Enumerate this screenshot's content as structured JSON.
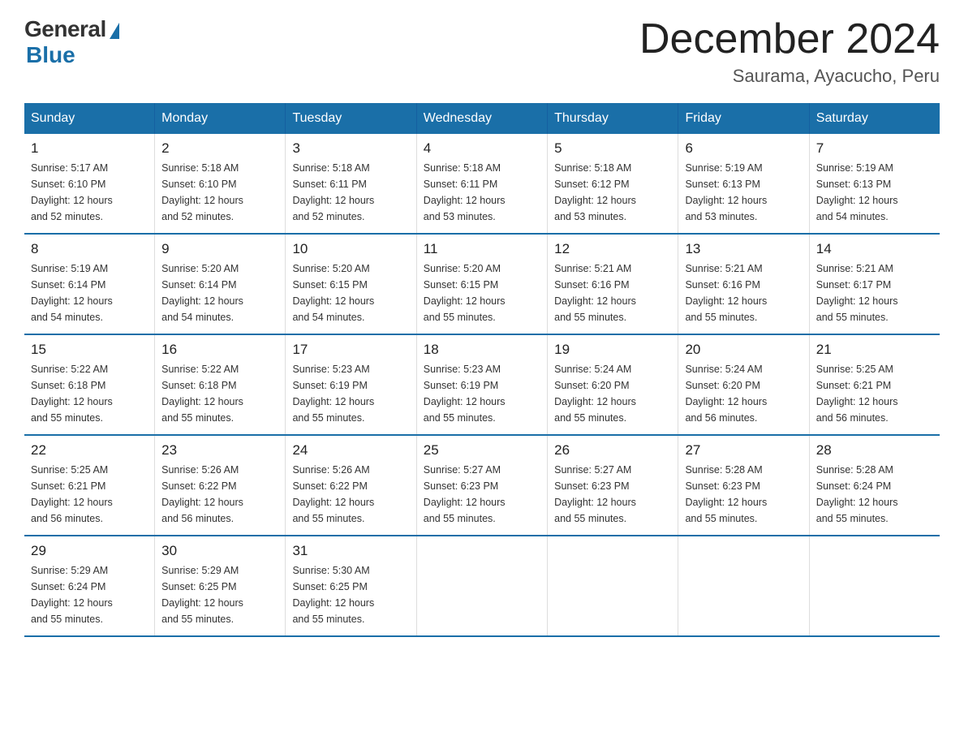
{
  "logo": {
    "general": "General",
    "blue": "Blue"
  },
  "title": "December 2024",
  "location": "Saurama, Ayacucho, Peru",
  "days_of_week": [
    "Sunday",
    "Monday",
    "Tuesday",
    "Wednesday",
    "Thursday",
    "Friday",
    "Saturday"
  ],
  "weeks": [
    [
      {
        "day": "1",
        "sunrise": "5:17 AM",
        "sunset": "6:10 PM",
        "daylight": "12 hours and 52 minutes."
      },
      {
        "day": "2",
        "sunrise": "5:18 AM",
        "sunset": "6:10 PM",
        "daylight": "12 hours and 52 minutes."
      },
      {
        "day": "3",
        "sunrise": "5:18 AM",
        "sunset": "6:11 PM",
        "daylight": "12 hours and 52 minutes."
      },
      {
        "day": "4",
        "sunrise": "5:18 AM",
        "sunset": "6:11 PM",
        "daylight": "12 hours and 53 minutes."
      },
      {
        "day": "5",
        "sunrise": "5:18 AM",
        "sunset": "6:12 PM",
        "daylight": "12 hours and 53 minutes."
      },
      {
        "day": "6",
        "sunrise": "5:19 AM",
        "sunset": "6:13 PM",
        "daylight": "12 hours and 53 minutes."
      },
      {
        "day": "7",
        "sunrise": "5:19 AM",
        "sunset": "6:13 PM",
        "daylight": "12 hours and 54 minutes."
      }
    ],
    [
      {
        "day": "8",
        "sunrise": "5:19 AM",
        "sunset": "6:14 PM",
        "daylight": "12 hours and 54 minutes."
      },
      {
        "day": "9",
        "sunrise": "5:20 AM",
        "sunset": "6:14 PM",
        "daylight": "12 hours and 54 minutes."
      },
      {
        "day": "10",
        "sunrise": "5:20 AM",
        "sunset": "6:15 PM",
        "daylight": "12 hours and 54 minutes."
      },
      {
        "day": "11",
        "sunrise": "5:20 AM",
        "sunset": "6:15 PM",
        "daylight": "12 hours and 55 minutes."
      },
      {
        "day": "12",
        "sunrise": "5:21 AM",
        "sunset": "6:16 PM",
        "daylight": "12 hours and 55 minutes."
      },
      {
        "day": "13",
        "sunrise": "5:21 AM",
        "sunset": "6:16 PM",
        "daylight": "12 hours and 55 minutes."
      },
      {
        "day": "14",
        "sunrise": "5:21 AM",
        "sunset": "6:17 PM",
        "daylight": "12 hours and 55 minutes."
      }
    ],
    [
      {
        "day": "15",
        "sunrise": "5:22 AM",
        "sunset": "6:18 PM",
        "daylight": "12 hours and 55 minutes."
      },
      {
        "day": "16",
        "sunrise": "5:22 AM",
        "sunset": "6:18 PM",
        "daylight": "12 hours and 55 minutes."
      },
      {
        "day": "17",
        "sunrise": "5:23 AM",
        "sunset": "6:19 PM",
        "daylight": "12 hours and 55 minutes."
      },
      {
        "day": "18",
        "sunrise": "5:23 AM",
        "sunset": "6:19 PM",
        "daylight": "12 hours and 55 minutes."
      },
      {
        "day": "19",
        "sunrise": "5:24 AM",
        "sunset": "6:20 PM",
        "daylight": "12 hours and 55 minutes."
      },
      {
        "day": "20",
        "sunrise": "5:24 AM",
        "sunset": "6:20 PM",
        "daylight": "12 hours and 56 minutes."
      },
      {
        "day": "21",
        "sunrise": "5:25 AM",
        "sunset": "6:21 PM",
        "daylight": "12 hours and 56 minutes."
      }
    ],
    [
      {
        "day": "22",
        "sunrise": "5:25 AM",
        "sunset": "6:21 PM",
        "daylight": "12 hours and 56 minutes."
      },
      {
        "day": "23",
        "sunrise": "5:26 AM",
        "sunset": "6:22 PM",
        "daylight": "12 hours and 56 minutes."
      },
      {
        "day": "24",
        "sunrise": "5:26 AM",
        "sunset": "6:22 PM",
        "daylight": "12 hours and 55 minutes."
      },
      {
        "day": "25",
        "sunrise": "5:27 AM",
        "sunset": "6:23 PM",
        "daylight": "12 hours and 55 minutes."
      },
      {
        "day": "26",
        "sunrise": "5:27 AM",
        "sunset": "6:23 PM",
        "daylight": "12 hours and 55 minutes."
      },
      {
        "day": "27",
        "sunrise": "5:28 AM",
        "sunset": "6:23 PM",
        "daylight": "12 hours and 55 minutes."
      },
      {
        "day": "28",
        "sunrise": "5:28 AM",
        "sunset": "6:24 PM",
        "daylight": "12 hours and 55 minutes."
      }
    ],
    [
      {
        "day": "29",
        "sunrise": "5:29 AM",
        "sunset": "6:24 PM",
        "daylight": "12 hours and 55 minutes."
      },
      {
        "day": "30",
        "sunrise": "5:29 AM",
        "sunset": "6:25 PM",
        "daylight": "12 hours and 55 minutes."
      },
      {
        "day": "31",
        "sunrise": "5:30 AM",
        "sunset": "6:25 PM",
        "daylight": "12 hours and 55 minutes."
      },
      null,
      null,
      null,
      null
    ]
  ],
  "labels": {
    "sunrise": "Sunrise:",
    "sunset": "Sunset:",
    "daylight": "Daylight:"
  }
}
